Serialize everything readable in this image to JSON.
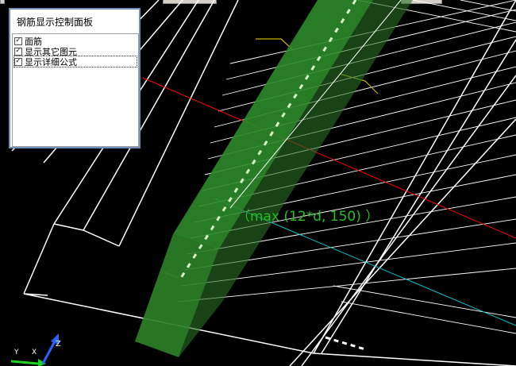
{
  "window": {
    "control_panel": {
      "title": "钢筋显示控制面板",
      "options": [
        {
          "label": "面筋",
          "checked": true
        },
        {
          "label": "显示其它图元",
          "checked": true
        },
        {
          "label": "显示详细公式",
          "checked": true
        }
      ]
    }
  },
  "viewport": {
    "formula_annotation": "（max (12*d, 150) ）",
    "axis_labels": {
      "x": "X",
      "y": "Y",
      "z": "Z"
    },
    "colors": {
      "background": "#000000",
      "slab": "#2e8a2a",
      "formula_text": "#22c022",
      "axis_red": "#ff0000",
      "axis_cyan": "#00c8d0",
      "outline_white": "#ffffff",
      "annotation_yellow": "#c8b400"
    }
  }
}
